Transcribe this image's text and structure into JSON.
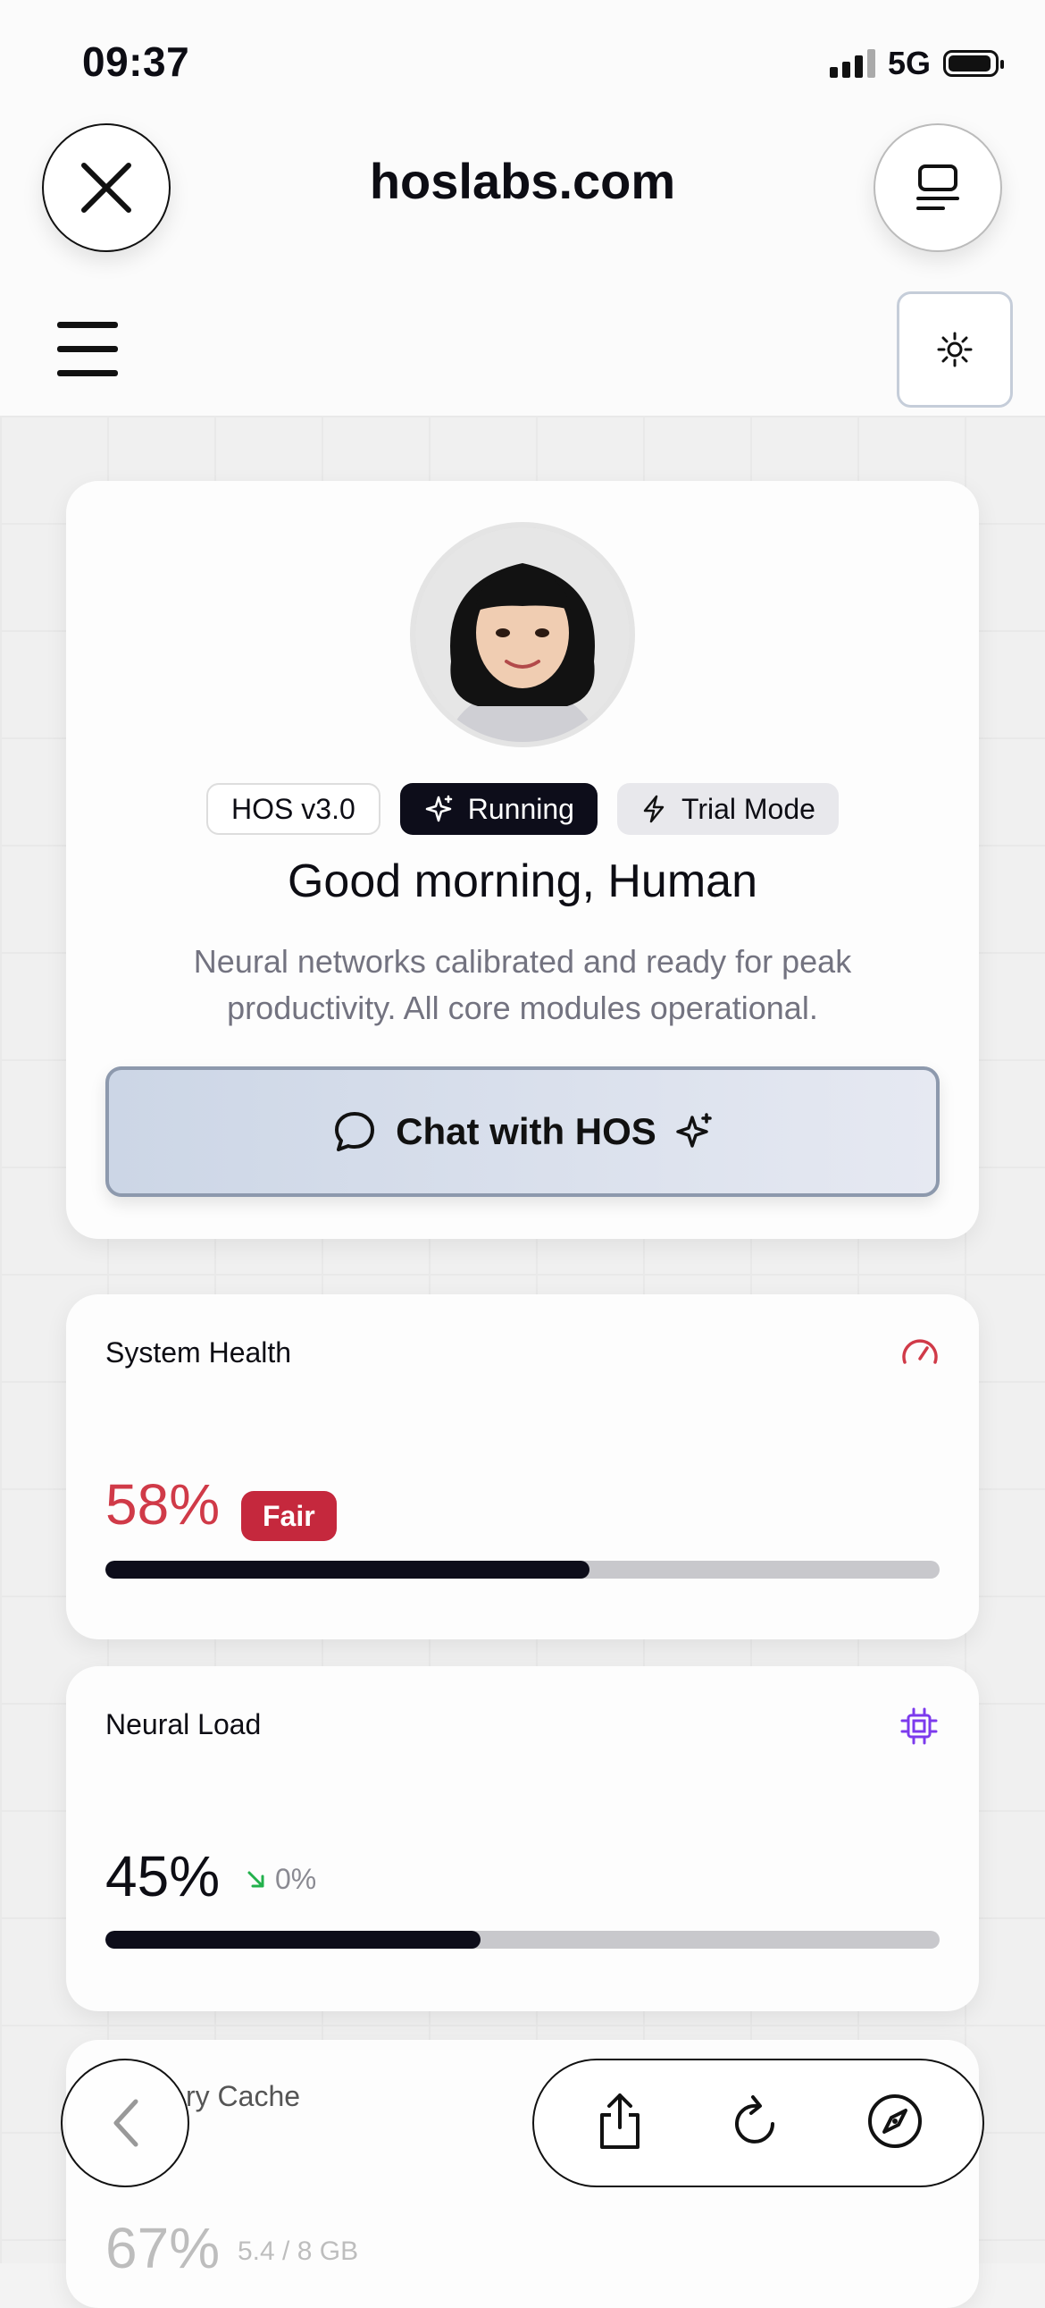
{
  "status_bar": {
    "time": "09:37",
    "network": "5G"
  },
  "browser": {
    "url": "hoslabs.com"
  },
  "hero": {
    "badges": [
      {
        "label": "HOS v3.0"
      },
      {
        "label": "Running",
        "icon": "sparkles-icon"
      },
      {
        "label": "Trial Mode",
        "icon": "lightning-icon"
      }
    ],
    "greeting": "Good morning, Human",
    "description": "Neural networks calibrated and ready for peak productivity. All core modules operational.",
    "chat_button": "Chat with HOS"
  },
  "metrics": {
    "system_health": {
      "title": "System Health",
      "value": "58%",
      "status": "Fair",
      "progress": 0.58,
      "color": "#d03a48",
      "icon": "gauge-icon"
    },
    "neural_load": {
      "title": "Neural Load",
      "value": "45%",
      "trend": "0%",
      "progress": 0.45,
      "color": "#7c3aed",
      "icon": "cpu-chip-icon"
    },
    "memory_cache": {
      "title": "ry Cache",
      "value": "67%",
      "detail": "5.4 / 8 GB"
    }
  },
  "colors": {
    "accent_dark": "#0d0d1a",
    "danger": "#c5283d",
    "trend_down": "#22b14c"
  }
}
